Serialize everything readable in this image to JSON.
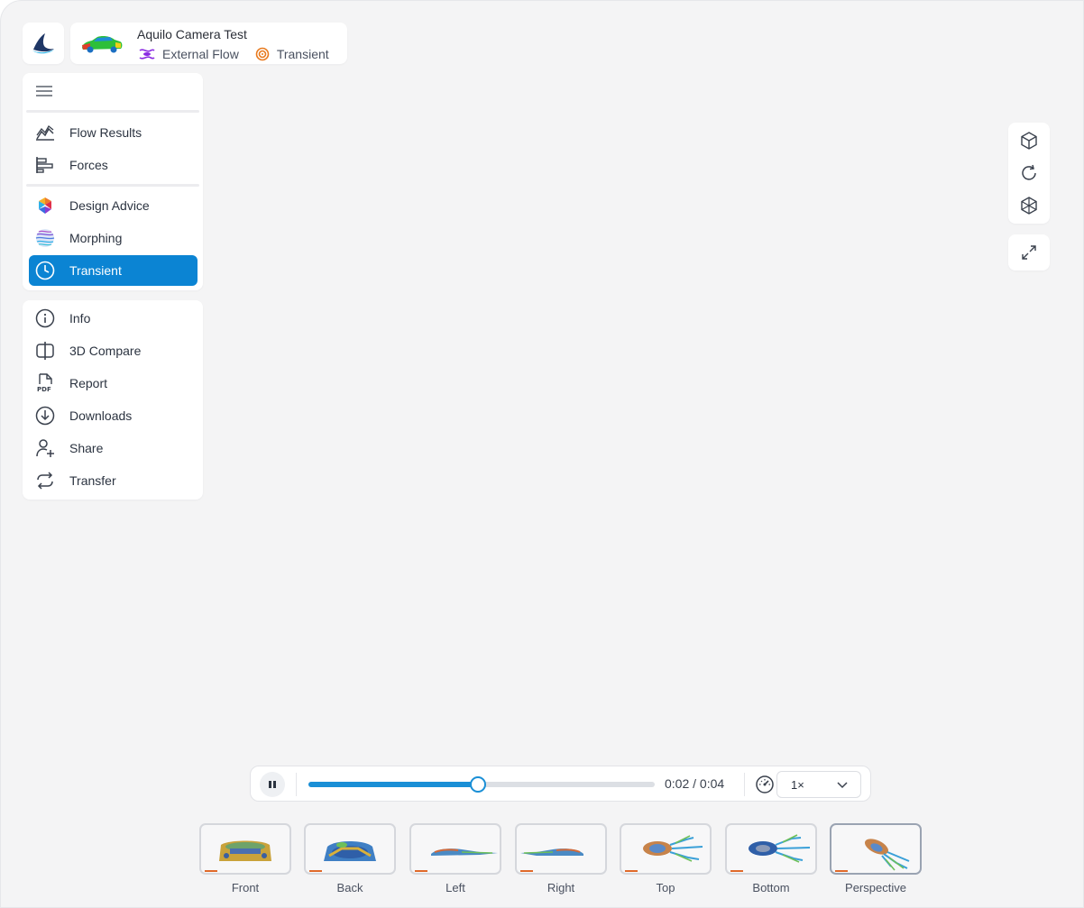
{
  "project": {
    "title": "Aquilo Camera Test",
    "tags": [
      {
        "label": "External Flow",
        "icon": "external-flow-icon",
        "color": "#8a2be2"
      },
      {
        "label": "Transient",
        "icon": "transient-icon",
        "color": "#e87a1e"
      }
    ]
  },
  "sidebar": {
    "menu_icon": "hamburger-icon",
    "results": [
      {
        "label": "Flow Results",
        "icon": "chart-area-icon"
      },
      {
        "label": "Forces",
        "icon": "bar-chart-horizontal-icon"
      }
    ],
    "tools": [
      {
        "label": "Design Advice",
        "icon": "design-advice-icon"
      },
      {
        "label": "Morphing",
        "icon": "morphing-icon"
      },
      {
        "label": "Transient",
        "icon": "clock-icon",
        "active": true
      }
    ],
    "actions": [
      {
        "label": "Info",
        "icon": "info-icon"
      },
      {
        "label": "3D Compare",
        "icon": "compare-icon"
      },
      {
        "label": "Report",
        "icon": "pdf-icon"
      },
      {
        "label": "Downloads",
        "icon": "download-icon"
      },
      {
        "label": "Share",
        "icon": "add-user-icon"
      },
      {
        "label": "Transfer",
        "icon": "transfer-icon"
      }
    ]
  },
  "toolbar": {
    "buttons": [
      "cube-icon",
      "rotate-icon",
      "wireframe-icon"
    ],
    "fullscreen": "expand-icon"
  },
  "player": {
    "state": "playing",
    "progress": 0.49,
    "time": "0:02 / 0:04",
    "speed": "1×",
    "accent": "#1a8fd6"
  },
  "views": [
    {
      "label": "Front"
    },
    {
      "label": "Back"
    },
    {
      "label": "Left"
    },
    {
      "label": "Right"
    },
    {
      "label": "Top"
    },
    {
      "label": "Bottom"
    },
    {
      "label": "Perspective",
      "active": true
    }
  ],
  "colors": {
    "active_nav": "#0b84d3",
    "background": "#f4f4f5"
  }
}
